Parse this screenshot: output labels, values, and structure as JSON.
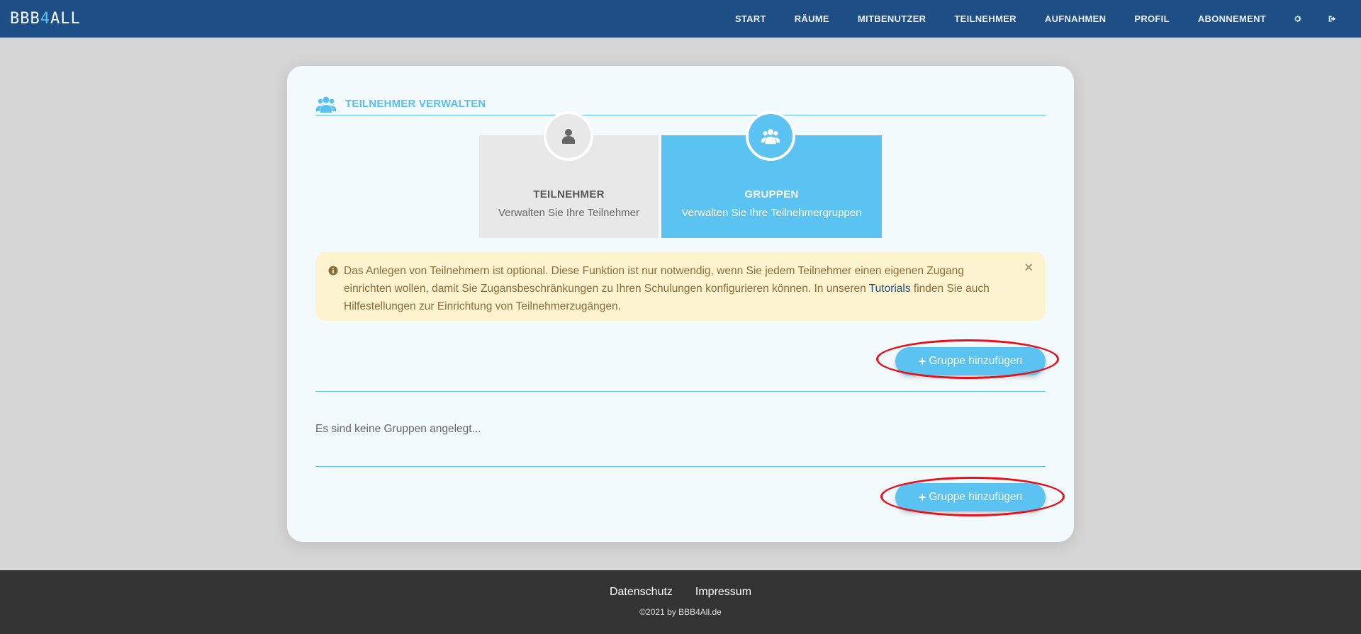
{
  "brand": {
    "name_part1": "BBB",
    "name_part2": "4",
    "name_part3": "ALL"
  },
  "nav": {
    "items": [
      "START",
      "RÄUME",
      "MITBENUTZER",
      "TEILNEHMER",
      "AUFNAHMEN",
      "PROFIL",
      "ABONNEMENT"
    ],
    "icons": [
      "gear-icon",
      "logout-icon"
    ]
  },
  "section": {
    "title": "TEILNEHMER VERWALTEN"
  },
  "tiles": [
    {
      "title": "TEILNEHMER",
      "subtitle": "Verwalten Sie Ihre Teilnehmer"
    },
    {
      "title": "GRUPPEN",
      "subtitle": "Verwalten Sie Ihre Teilnehmergruppen"
    }
  ],
  "alert": {
    "text_before": "Das Anlegen von Teilnehmern ist optional. Diese Funktion ist nur notwendig, wenn Sie jedem Teilnehmer einen eigenen Zugang einrichten wollen, damit Sie Zugansbeschränkungen zu Ihren Schulungen konfigurieren können. In unseren ",
    "link": "Tutorials",
    "text_after": " finden Sie auch Hilfestellungen zur Einrichtung von Teilnehmerzugängen.",
    "close": "×"
  },
  "actions": {
    "add_group": "Gruppe hinzufügen",
    "add_icon": "+"
  },
  "groups": {
    "empty_message": "Es sind keine Gruppen angelegt..."
  },
  "footer": {
    "links": [
      "Datenschutz",
      "Impressum"
    ],
    "copyright": "©2021 by BBB4All.de"
  },
  "colors": {
    "navbar": "#1d4f86",
    "accent": "#5bc3f2",
    "alert_bg": "#fdf3cf",
    "annotation": "#e8101b"
  }
}
